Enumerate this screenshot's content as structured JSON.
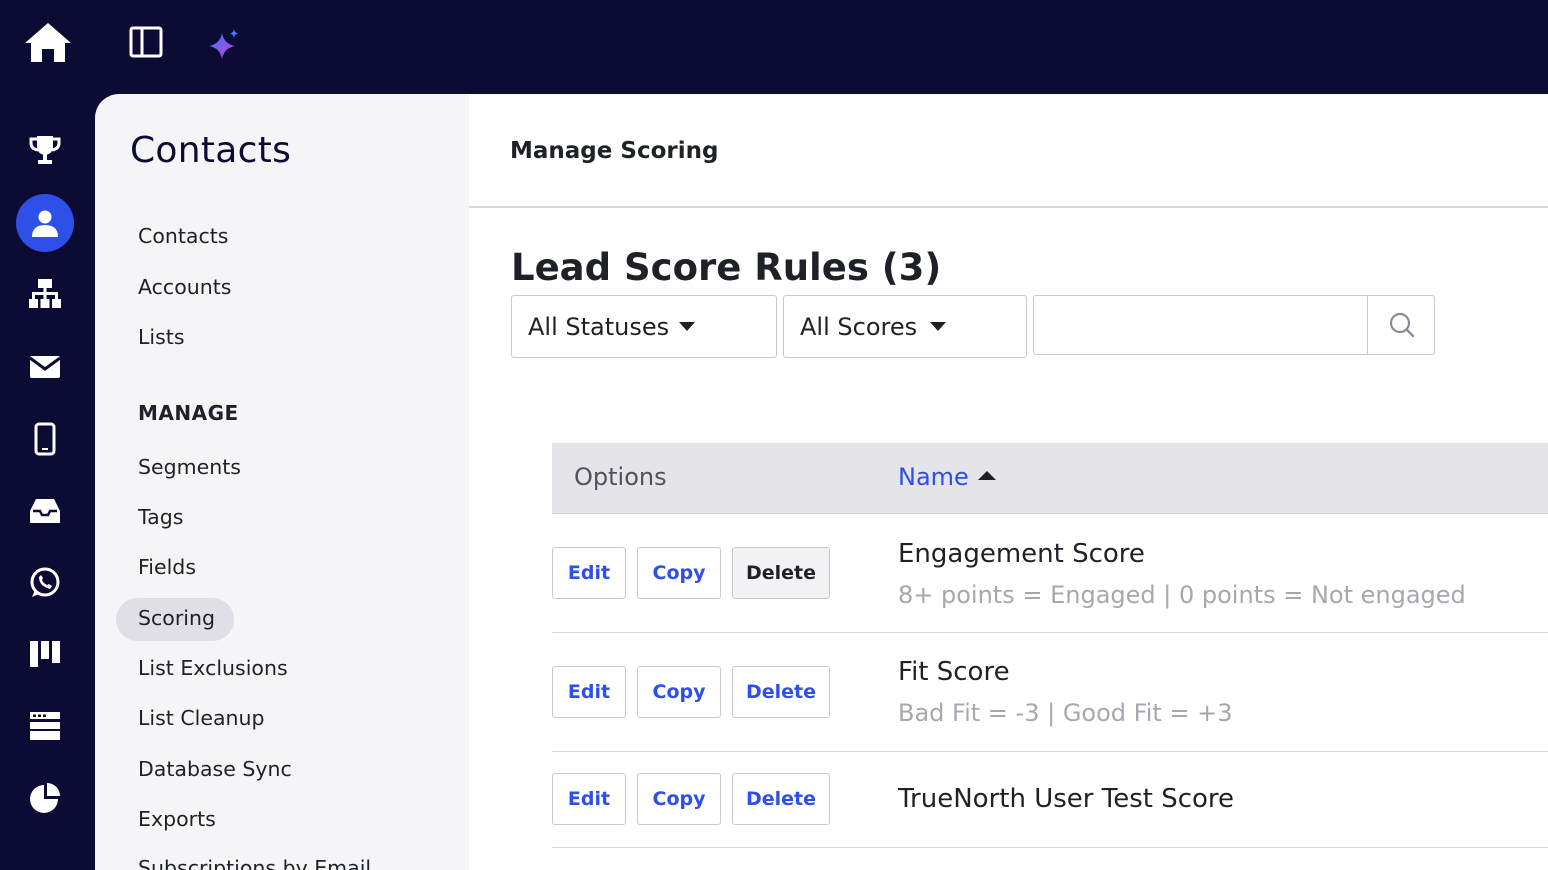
{
  "topbar": {
    "icons": [
      "home-icon",
      "panel-toggle-icon",
      "sparkle-icon"
    ]
  },
  "rail": {
    "icons": [
      "trophy-icon",
      "contacts-icon",
      "automations-icon",
      "email-icon",
      "mobile-icon",
      "inbox-icon",
      "whatsapp-icon",
      "pipeline-icon",
      "website-icon",
      "reports-icon"
    ],
    "active": "contacts-icon"
  },
  "sidebar": {
    "title": "Contacts",
    "items": [
      {
        "label": "Contacts"
      },
      {
        "label": "Accounts"
      },
      {
        "label": "Lists"
      }
    ],
    "section_label": "MANAGE",
    "manage_items": [
      {
        "label": "Segments"
      },
      {
        "label": "Tags"
      },
      {
        "label": "Fields"
      },
      {
        "label": "Scoring"
      },
      {
        "label": "List Exclusions"
      },
      {
        "label": "List Cleanup"
      },
      {
        "label": "Database Sync"
      },
      {
        "label": "Exports"
      },
      {
        "label": "Subscriptions by Email"
      }
    ],
    "active_item": "Scoring"
  },
  "header": {
    "title": "Manage Scoring"
  },
  "main": {
    "section_title": "Lead Score Rules (3)",
    "filters": {
      "status": "All Statuses",
      "scores": "All Scores"
    },
    "search": {
      "value": "",
      "placeholder": ""
    },
    "table": {
      "columns": {
        "options": "Options",
        "name": "Name"
      },
      "sort": "ascending",
      "actions": {
        "edit": "Edit",
        "copy": "Copy",
        "delete": "Delete"
      },
      "rows": [
        {
          "name": "Engagement Score",
          "description": "8+ points = Engaged | 0 points = Not engaged"
        },
        {
          "name": "Fit Score",
          "description": "Bad Fit = -3 | Good Fit = +3"
        },
        {
          "name": "TrueNorth User Test Score",
          "description": ""
        }
      ]
    }
  },
  "colors": {
    "nav_bg": "#0c0b33",
    "accent": "#2e4fe8",
    "sidebar_bg": "#f5f5f7",
    "table_header_bg": "#e5e5e9"
  }
}
